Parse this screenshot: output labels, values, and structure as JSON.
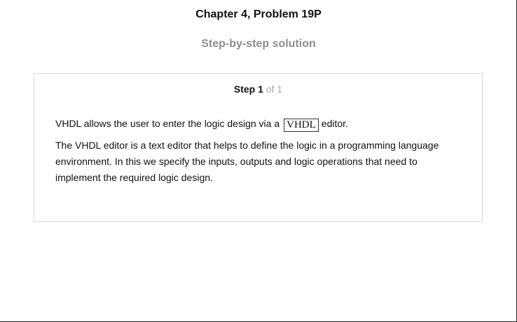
{
  "header": {
    "title": "Chapter 4, Problem 19P",
    "subtitle": "Step-by-step solution"
  },
  "step": {
    "label": "Step 1",
    "of_text": "of 1",
    "paragraph1_before": "VHDL allows the user to enter the logic design via a",
    "paragraph1_boxed": "VHDL",
    "paragraph1_after": "editor.",
    "paragraph2": "The VHDL editor is a text editor that helps to define the logic in a programming language environment. In this we specify the inputs, outputs and logic operations that need to implement the required logic design."
  }
}
